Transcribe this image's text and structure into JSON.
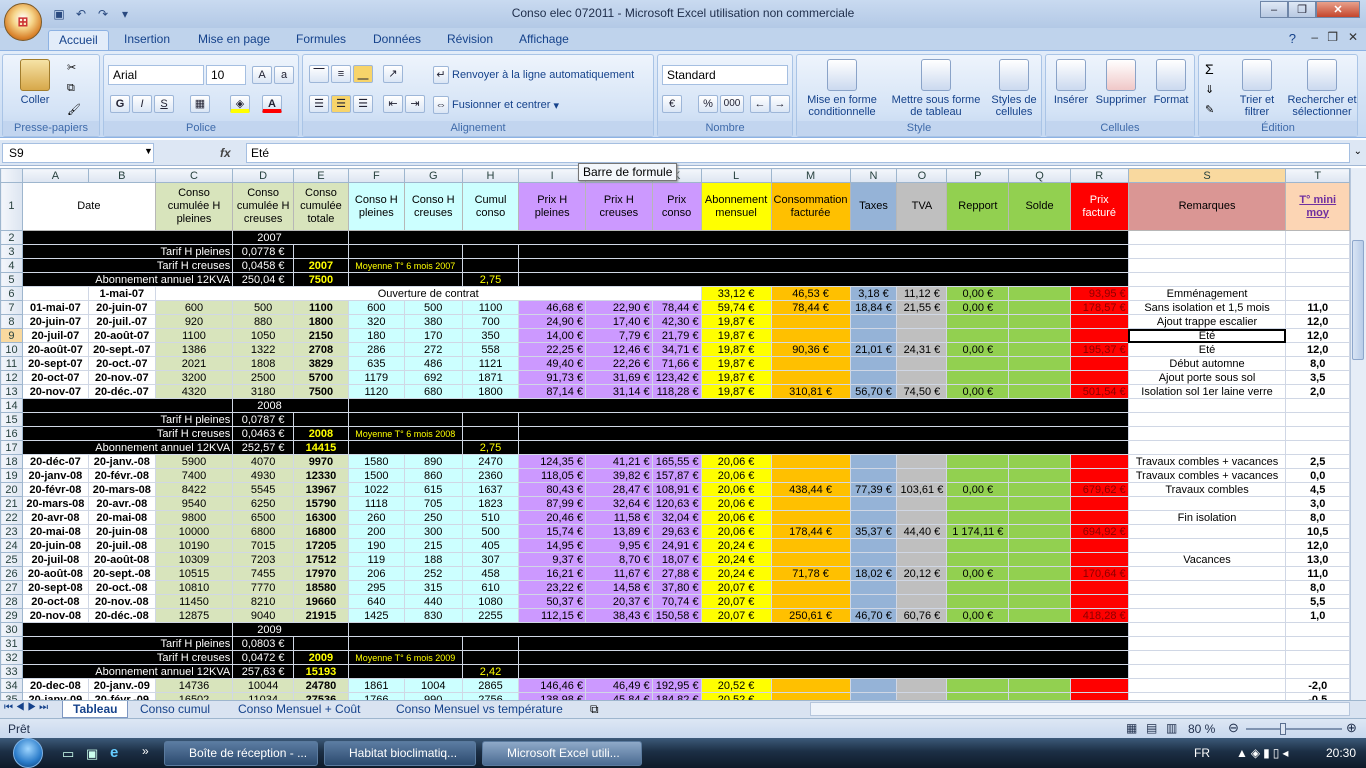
{
  "window": {
    "title": "Conso elec 072011 - Microsoft Excel utilisation non commerciale"
  },
  "ribbon": {
    "tabs": [
      "Accueil",
      "Insertion",
      "Mise en page",
      "Formules",
      "Données",
      "Révision",
      "Affichage"
    ],
    "groups": {
      "clipboard": "Presse-papiers",
      "font": "Police",
      "alignment": "Alignement",
      "number": "Nombre",
      "style": "Style",
      "cells": "Cellules",
      "edit": "Édition"
    },
    "paste": "Coller",
    "font_name": "Arial",
    "font_size": "10",
    "wrap": "Renvoyer à la ligne automatiquement",
    "merge": "Fusionner et centrer",
    "number_format": "Standard",
    "cond_format": "Mise en forme conditionnelle",
    "table_format": "Mettre sous forme de tableau",
    "cell_styles": "Styles de cellules",
    "insert": "Insérer",
    "delete": "Supprimer",
    "format": "Format",
    "sort": "Trier et filtrer",
    "find": "Rechercher et sélectionner",
    "bold": "G",
    "italic": "I",
    "underline": "S",
    "percent": "%",
    "thousands": "000"
  },
  "formula_bar": {
    "cell": "S9",
    "fx": "fx",
    "value": "Eté",
    "tooltip": "Barre de formule"
  },
  "columns": [
    "A",
    "B",
    "C",
    "D",
    "E",
    "F",
    "G",
    "H",
    "I",
    "J",
    "K",
    "L",
    "M",
    "N",
    "O",
    "P",
    "Q",
    "R",
    "S",
    "T"
  ],
  "headers": {
    "date": "Date",
    "c": "Conso cumulée H pleines",
    "d": "Conso cumulée H creuses",
    "e": "Conso cumulée totale",
    "f": "Conso H pleines",
    "g": "Conso H creuses",
    "h": "Cumul conso",
    "i": "Prix H pleines",
    "j": "Prix H creuses",
    "k": "Prix conso",
    "l": "Abonnement mensuel",
    "m": "Consommation facturée",
    "n": "Taxes",
    "o": "TVA",
    "p": "Repport",
    "q": "Solde",
    "r": "Prix facturé",
    "s": "Remarques",
    "t": "T° mini moy"
  },
  "rows": [
    {
      "n": "2",
      "type": "year",
      "c": "2007"
    },
    {
      "n": "3",
      "type": "tarif",
      "label": "Tarif H pleines",
      "val": "0,0778 €"
    },
    {
      "n": "4",
      "type": "tarif",
      "label": "Tarif H creuses",
      "val": "0,0458 €",
      "e": "2007",
      "note": "Moyenne T° 6 mois 2007"
    },
    {
      "n": "5",
      "type": "tarif",
      "label": "Abonnement annuel 12KVA",
      "val": "250,04 €",
      "e": "7500",
      "g": "2,75"
    },
    {
      "n": "6",
      "type": "data",
      "a": "",
      "b": "1-mai-07",
      "f": "Ouverture de contrat",
      "l": "33,12 €",
      "m": "46,53 €",
      "nn": "3,18 €",
      "o": "11,12 €",
      "p": "0,00 €",
      "r": "93,95 €",
      "s": "Emménagement",
      "t": ""
    },
    {
      "n": "7",
      "type": "data",
      "a": "01-mai-07",
      "b": "20-juin-07",
      "c": "600",
      "d": "500",
      "e": "1100",
      "f": "600",
      "g": "500",
      "h": "1100",
      "i": "46,68 €",
      "j": "22,90 €",
      "k": "78,44 €",
      "l": "59,74 €",
      "m": "78,44 €",
      "nn": "18,84 €",
      "o": "21,55 €",
      "p": "0,00 €",
      "r": "178,57 €",
      "s": "Sans isolation et 1,5 mois",
      "t": "11,0"
    },
    {
      "n": "8",
      "type": "data",
      "a": "20-juin-07",
      "b": "20-juil.-07",
      "c": "920",
      "d": "880",
      "e": "1800",
      "f": "320",
      "g": "380",
      "h": "700",
      "i": "24,90 €",
      "j": "17,40 €",
      "k": "42,30 €",
      "l": "19,87 €",
      "s": "Ajout trappe escalier",
      "t": "12,0"
    },
    {
      "n": "9",
      "type": "data",
      "a": "20-juil-07",
      "b": "20-août-07",
      "c": "1100",
      "d": "1050",
      "e": "2150",
      "f": "180",
      "g": "170",
      "h": "350",
      "i": "14,00 €",
      "j": "7,79 €",
      "k": "21,79 €",
      "l": "19,87 €",
      "s": "Eté",
      "t": "12,0",
      "sel": true
    },
    {
      "n": "10",
      "type": "data",
      "a": "20-août-07",
      "b": "20-sept.-07",
      "c": "1386",
      "d": "1322",
      "e": "2708",
      "f": "286",
      "g": "272",
      "h": "558",
      "i": "22,25 €",
      "j": "12,46 €",
      "k": "34,71 €",
      "l": "19,87 €",
      "m": "90,36 €",
      "nn": "21,01 €",
      "o": "24,31 €",
      "p": "0,00 €",
      "r": "195,37 €",
      "s": "Eté",
      "t": "12,0"
    },
    {
      "n": "11",
      "type": "data",
      "a": "20-sept-07",
      "b": "20-oct.-07",
      "c": "2021",
      "d": "1808",
      "e": "3829",
      "f": "635",
      "g": "486",
      "h": "1121",
      "i": "49,40 €",
      "j": "22,26 €",
      "k": "71,66 €",
      "l": "19,87 €",
      "s": "Début automne",
      "t": "8,0"
    },
    {
      "n": "12",
      "type": "data",
      "a": "20-oct-07",
      "b": "20-nov.-07",
      "c": "3200",
      "d": "2500",
      "e": "5700",
      "f": "1179",
      "g": "692",
      "h": "1871",
      "i": "91,73 €",
      "j": "31,69 €",
      "k": "123,42 €",
      "l": "19,87 €",
      "s": "Ajout porte sous sol",
      "t": "3,5"
    },
    {
      "n": "13",
      "type": "data",
      "a": "20-nov-07",
      "b": "20-déc.-07",
      "c": "4320",
      "d": "3180",
      "e": "7500",
      "f": "1120",
      "g": "680",
      "h": "1800",
      "i": "87,14 €",
      "j": "31,14 €",
      "k": "118,28 €",
      "l": "19,87 €",
      "m": "310,81 €",
      "nn": "56,70 €",
      "o": "74,50 €",
      "p": "0,00 €",
      "r": "501,54 €",
      "s": "Isolation sol 1er laine verre",
      "t": "2,0"
    },
    {
      "n": "14",
      "type": "year",
      "c": "2008"
    },
    {
      "n": "15",
      "type": "tarif",
      "label": "Tarif H pleines",
      "val": "0,0787 €"
    },
    {
      "n": "16",
      "type": "tarif",
      "label": "Tarif H creuses",
      "val": "0,0463 €",
      "e": "2008",
      "note": "Moyenne T° 6 mois 2008"
    },
    {
      "n": "17",
      "type": "tarif",
      "label": "Abonnement annuel 12KVA",
      "val": "252,57 €",
      "e": "14415",
      "g": "2,75"
    },
    {
      "n": "18",
      "type": "data",
      "a": "20-déc-07",
      "b": "20-janv.-08",
      "c": "5900",
      "d": "4070",
      "e": "9970",
      "f": "1580",
      "g": "890",
      "h": "2470",
      "i": "124,35 €",
      "j": "41,21 €",
      "k": "165,55 €",
      "l": "20,06 €",
      "s": "Travaux combles + vacances",
      "t": "2,5"
    },
    {
      "n": "19",
      "type": "data",
      "a": "20-janv-08",
      "b": "20-févr.-08",
      "c": "7400",
      "d": "4930",
      "e": "12330",
      "f": "1500",
      "g": "860",
      "h": "2360",
      "i": "118,05 €",
      "j": "39,82 €",
      "k": "157,87 €",
      "l": "20,06 €",
      "s": "Travaux combles + vacances",
      "t": "0,0"
    },
    {
      "n": "20",
      "type": "data",
      "a": "20-févr-08",
      "b": "20-mars-08",
      "c": "8422",
      "d": "5545",
      "e": "13967",
      "f": "1022",
      "g": "615",
      "h": "1637",
      "i": "80,43 €",
      "j": "28,47 €",
      "k": "108,91 €",
      "l": "20,06 €",
      "m": "438,44 €",
      "nn": "77,39 €",
      "o": "103,61 €",
      "p": "0,00 €",
      "r": "679,62 €",
      "s": "Travaux combles",
      "t": "4,5"
    },
    {
      "n": "21",
      "type": "data",
      "a": "20-mars-08",
      "b": "20-avr.-08",
      "c": "9540",
      "d": "6250",
      "e": "15790",
      "f": "1118",
      "g": "705",
      "h": "1823",
      "i": "87,99 €",
      "j": "32,64 €",
      "k": "120,63 €",
      "l": "20,06 €",
      "s": "",
      "t": "3,0"
    },
    {
      "n": "22",
      "type": "data",
      "a": "20-avr-08",
      "b": "20-mai-08",
      "c": "9800",
      "d": "6500",
      "e": "16300",
      "f": "260",
      "g": "250",
      "h": "510",
      "i": "20,46 €",
      "j": "11,58 €",
      "k": "32,04 €",
      "l": "20,06 €",
      "s": "Fin isolation",
      "t": "8,0"
    },
    {
      "n": "23",
      "type": "data",
      "a": "20-mai-08",
      "b": "20-juin-08",
      "c": "10000",
      "d": "6800",
      "e": "16800",
      "f": "200",
      "g": "300",
      "h": "500",
      "i": "15,74 €",
      "j": "13,89 €",
      "k": "29,63 €",
      "l": "20,06 €",
      "m": "178,44 €",
      "nn": "35,37 €",
      "o": "44,40 €",
      "p": "1 174,11 €",
      "r": "694,92 €",
      "s": "",
      "t": "10,5"
    },
    {
      "n": "24",
      "type": "data",
      "a": "20-juin-08",
      "b": "20-juil.-08",
      "c": "10190",
      "d": "7015",
      "e": "17205",
      "f": "190",
      "g": "215",
      "h": "405",
      "i": "14,95 €",
      "j": "9,95 €",
      "k": "24,91 €",
      "l": "20,24 €",
      "s": "",
      "t": "12,0"
    },
    {
      "n": "25",
      "type": "data",
      "a": "20-juil-08",
      "b": "20-août-08",
      "c": "10309",
      "d": "7203",
      "e": "17512",
      "f": "119",
      "g": "188",
      "h": "307",
      "i": "9,37 €",
      "j": "8,70 €",
      "k": "18,07 €",
      "l": "20,24 €",
      "s": "Vacances",
      "t": "13,0"
    },
    {
      "n": "26",
      "type": "data",
      "a": "20-août-08",
      "b": "20-sept.-08",
      "c": "10515",
      "d": "7455",
      "e": "17970",
      "f": "206",
      "g": "252",
      "h": "458",
      "i": "16,21 €",
      "j": "11,67 €",
      "k": "27,88 €",
      "l": "20,24 €",
      "m": "71,78 €",
      "nn": "18,02 €",
      "o": "20,12 €",
      "p": "0,00 €",
      "r": "170,64 €",
      "s": "",
      "t": "11,0"
    },
    {
      "n": "27",
      "type": "data",
      "a": "20-sept-08",
      "b": "20-oct.-08",
      "c": "10810",
      "d": "7770",
      "e": "18580",
      "f": "295",
      "g": "315",
      "h": "610",
      "i": "23,22 €",
      "j": "14,58 €",
      "k": "37,80 €",
      "l": "20,07 €",
      "s": "",
      "t": "8,0"
    },
    {
      "n": "28",
      "type": "data",
      "a": "20-oct-08",
      "b": "20-nov.-08",
      "c": "11450",
      "d": "8210",
      "e": "19660",
      "f": "640",
      "g": "440",
      "h": "1080",
      "i": "50,37 €",
      "j": "20,37 €",
      "k": "70,74 €",
      "l": "20,07 €",
      "s": "",
      "t": "5,5"
    },
    {
      "n": "29",
      "type": "data",
      "a": "20-nov-08",
      "b": "20-déc.-08",
      "c": "12875",
      "d": "9040",
      "e": "21915",
      "f": "1425",
      "g": "830",
      "h": "2255",
      "i": "112,15 €",
      "j": "38,43 €",
      "k": "150,58 €",
      "l": "20,07 €",
      "m": "250,61 €",
      "nn": "46,70 €",
      "o": "60,76 €",
      "p": "0,00 €",
      "r": "418,28 €",
      "s": "",
      "t": "1,0"
    },
    {
      "n": "30",
      "type": "year",
      "c": "2009"
    },
    {
      "n": "31",
      "type": "tarif",
      "label": "Tarif H pleines",
      "val": "0,0803 €"
    },
    {
      "n": "32",
      "type": "tarif",
      "label": "Tarif H creuses",
      "val": "0,0472 €",
      "e": "2009",
      "note": "Moyenne T° 6 mois 2009"
    },
    {
      "n": "33",
      "type": "tarif",
      "label": "Abonnement annuel 12KVA",
      "val": "257,63 €",
      "e": "15193",
      "g": "2,42"
    },
    {
      "n": "34",
      "type": "data",
      "a": "20-dec-08",
      "b": "20-janv.-09",
      "c": "14736",
      "d": "10044",
      "e": "24780",
      "f": "1861",
      "g": "1004",
      "h": "2865",
      "i": "146,46 €",
      "j": "46,49 €",
      "k": "192,95 €",
      "l": "20,52 €",
      "s": "",
      "t": "-2,0"
    },
    {
      "n": "35",
      "type": "data",
      "a": "20-janv-09",
      "b": "20-févr.-09",
      "c": "16502",
      "d": "11034",
      "e": "27536",
      "f": "1766",
      "g": "990",
      "h": "2756",
      "i": "138,98 €",
      "j": "45,84 €",
      "k": "184,82 €",
      "l": "20,52 €",
      "s": "",
      "t": "-0,5"
    }
  ],
  "sheet_tabs": [
    "Tableau",
    "Conso cumul",
    "Conso Mensuel + Coût",
    "Conso Mensuel vs température"
  ],
  "status": {
    "ready": "Prêt",
    "zoom": "80 %"
  },
  "taskbar": {
    "items": [
      "Boîte de réception - ...",
      "Habitat bioclimatiq...",
      "Microsoft Excel utili..."
    ],
    "lang": "FR",
    "time": "20:30"
  }
}
